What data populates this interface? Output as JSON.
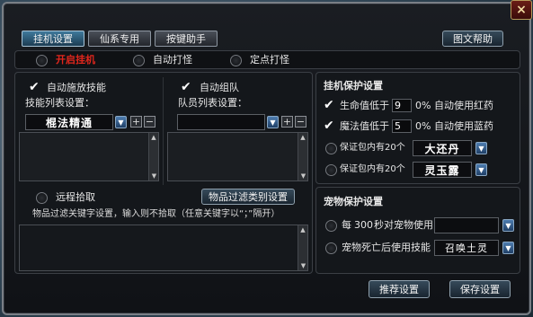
{
  "window": {
    "close_label": "×"
  },
  "tabs": [
    {
      "label": "挂机设置",
      "active": true
    },
    {
      "label": "仙系专用",
      "active": false
    },
    {
      "label": "按键助手",
      "active": false
    }
  ],
  "help_button": "图文帮助",
  "mode_bar": {
    "start": "开启挂机",
    "auto_fight": "自动打怪",
    "fixed_fight": "定点打怪"
  },
  "skills": {
    "checkbox_label": "自动施放技能",
    "list_label": "技能列表设置：",
    "selected_skill": "棍法精通"
  },
  "team": {
    "checkbox_label": "自动组队",
    "list_label": "队员列表设置："
  },
  "pickup": {
    "radio_label": "远程拾取",
    "filter_button": "物品过滤类别设置",
    "hint": "物品过滤关键字设置，输入则不拾取（任意关键字以“；”隔开）"
  },
  "protect": {
    "title": "挂机保护设置",
    "hp_label": "生命值低于",
    "hp_value": "9",
    "hp_suffix": "0%  自动使用红药",
    "mp_label": "魔法值低于",
    "mp_value": "5",
    "mp_suffix": "0%  自动使用蓝药",
    "pack1_label": "保证包内有20个",
    "pack1_item": "大还丹",
    "pack2_label": "保证包内有20个",
    "pack2_item": "灵玉露"
  },
  "pet": {
    "title": "宠物保护设置",
    "every_prefix": "每",
    "every_value": "300",
    "every_suffix": "秒对宠物使用",
    "death_label": "宠物死亡后使用技能",
    "death_skill": "召唤土灵"
  },
  "footer": {
    "recommend": "推荐设置",
    "save": "保存设置"
  },
  "colors": {
    "accent_red": "#e0261c",
    "frame": "#7a7f86"
  }
}
